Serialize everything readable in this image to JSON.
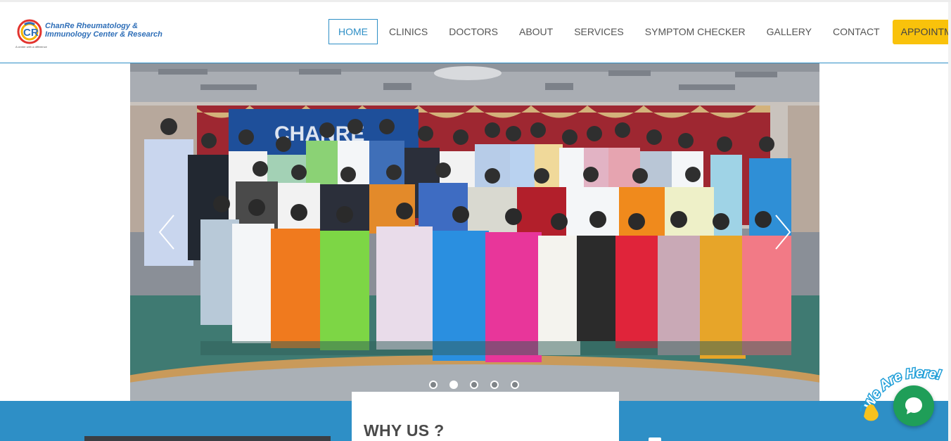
{
  "brand": {
    "name_line1": "ChanRe Rheumatology &",
    "name_line2": "Immunology Center & Research",
    "tagline": "A center with a difference",
    "logo_letters": "CR",
    "colors": {
      "blue": "#2f6fb8",
      "accent": "#2e8fc6",
      "cta": "#f9c20b"
    }
  },
  "nav": {
    "items": [
      {
        "label": "HOME",
        "active": true
      },
      {
        "label": "CLINICS"
      },
      {
        "label": "DOCTORS"
      },
      {
        "label": "ABOUT"
      },
      {
        "label": "SERVICES"
      },
      {
        "label": "SYMPTOM CHECKER"
      },
      {
        "label": "GALLERY"
      },
      {
        "label": "CONTACT"
      }
    ],
    "cta": "APPOINTMENT"
  },
  "carousel": {
    "banner_text": "CHANRE RHEUMATOLOGY",
    "prev_icon": "chevron-left-icon",
    "next_icon": "chevron-right-icon",
    "slide_count": 5,
    "active_slide": 2
  },
  "section": {
    "heading": "WHY US ?"
  },
  "chat": {
    "badge_text": "We Are Here!",
    "icon": "chat-bubble-icon",
    "wave_icon": "waving-hand-icon",
    "color": "#1f9e58"
  }
}
